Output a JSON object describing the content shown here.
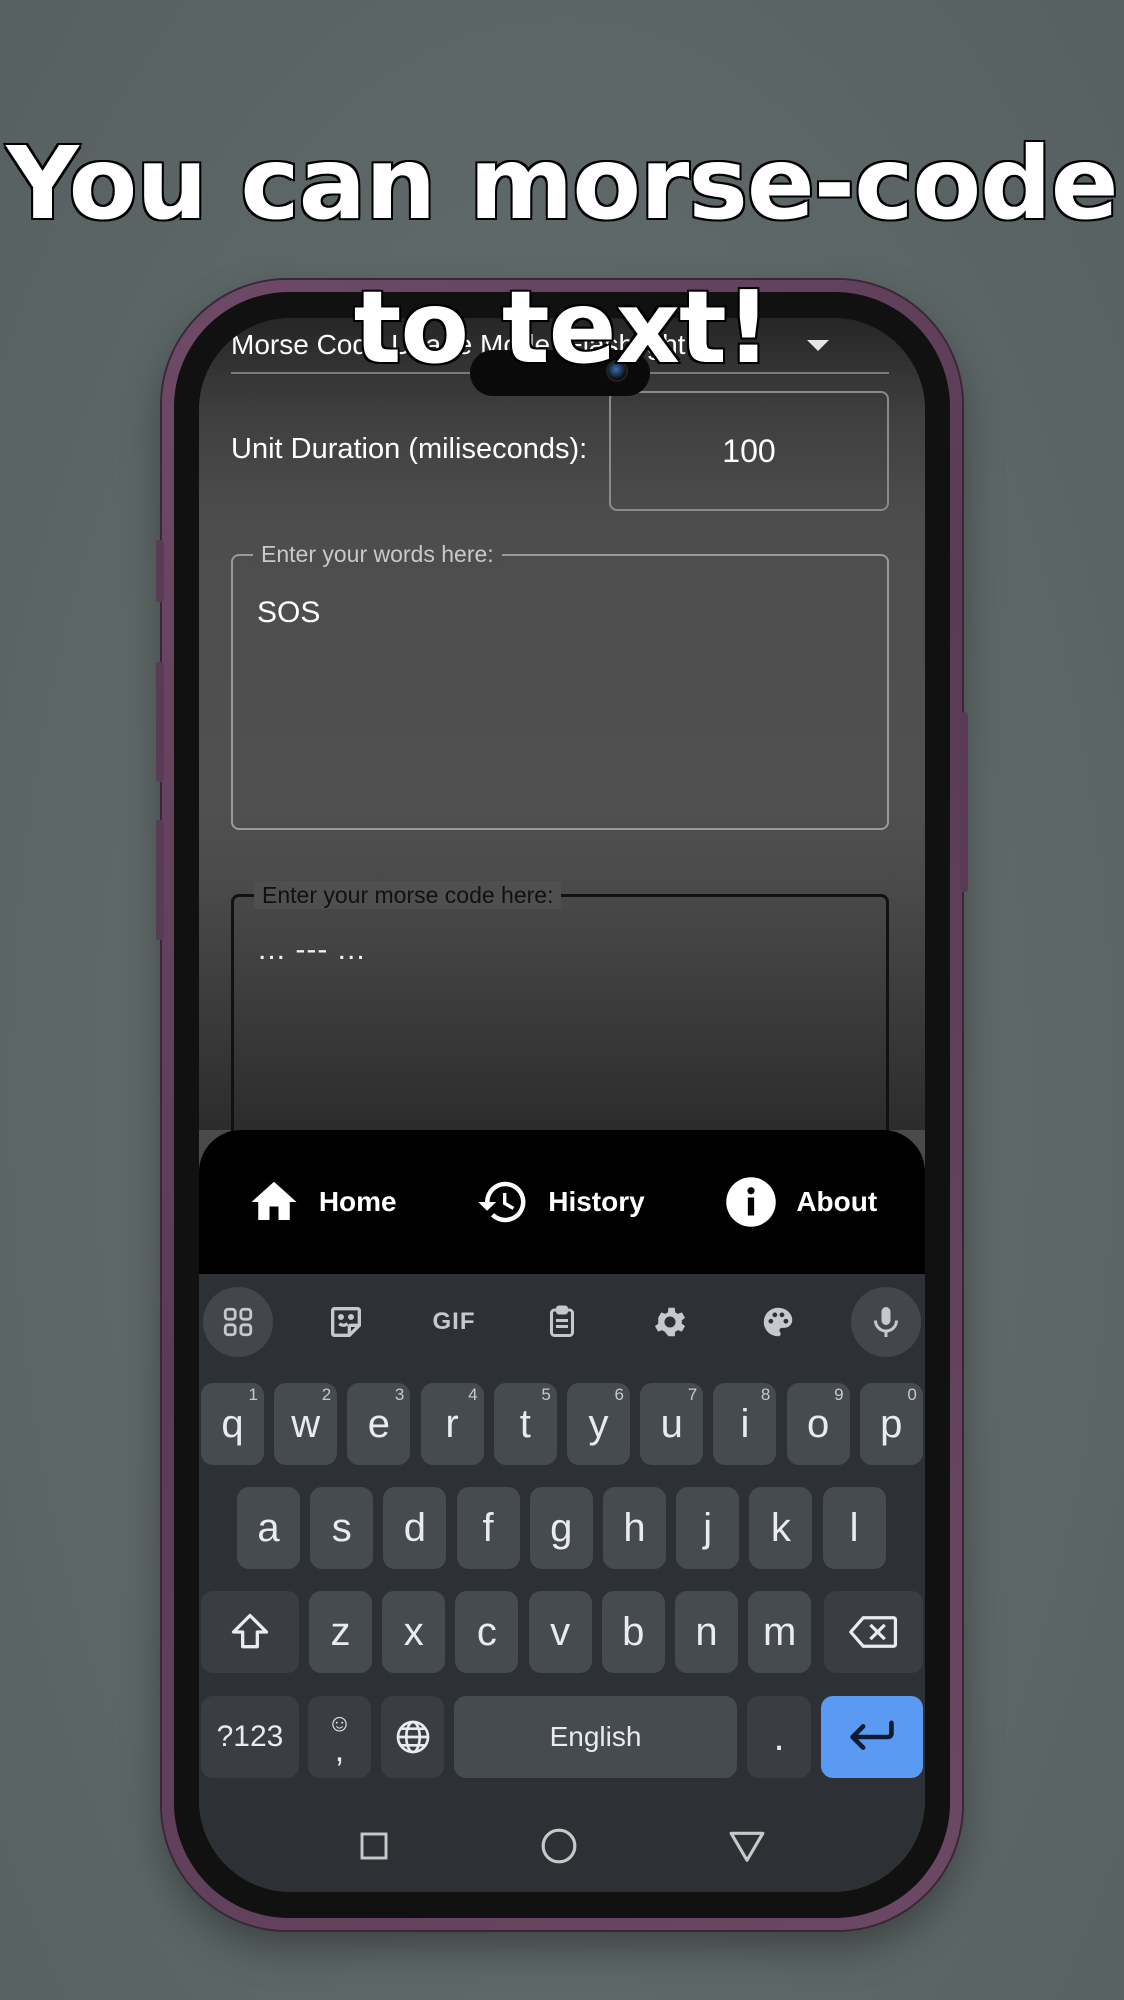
{
  "headline": {
    "line1": "You can morse-code",
    "line2": "to text!"
  },
  "app": {
    "dropdown_label": "Morse Code Usage Mode: Flashlight",
    "unit_duration_label": "Unit Duration (miliseconds):",
    "unit_duration_value": "100",
    "words_field": {
      "label": "Enter your words here:",
      "value": "SOS"
    },
    "morse_field": {
      "label": "Enter your morse code here:",
      "value": "... --- ..."
    }
  },
  "bottom_nav": {
    "items": [
      {
        "label": "Home",
        "icon": "home-icon"
      },
      {
        "label": "History",
        "icon": "history-icon"
      },
      {
        "label": "About",
        "icon": "info-icon"
      }
    ]
  },
  "keyboard": {
    "toolbar": [
      "apps-grid-icon",
      "sticker-icon",
      "GIF",
      "clipboard-icon",
      "gear-icon",
      "palette-icon",
      "mic-icon"
    ],
    "gif_label": "GIF",
    "row1": [
      {
        "k": "q",
        "n": "1"
      },
      {
        "k": "w",
        "n": "2"
      },
      {
        "k": "e",
        "n": "3"
      },
      {
        "k": "r",
        "n": "4"
      },
      {
        "k": "t",
        "n": "5"
      },
      {
        "k": "y",
        "n": "6"
      },
      {
        "k": "u",
        "n": "7"
      },
      {
        "k": "i",
        "n": "8"
      },
      {
        "k": "o",
        "n": "9"
      },
      {
        "k": "p",
        "n": "0"
      }
    ],
    "row2": [
      "a",
      "s",
      "d",
      "f",
      "g",
      "h",
      "j",
      "k",
      "l"
    ],
    "row3": [
      "z",
      "x",
      "c",
      "v",
      "b",
      "n",
      "m"
    ],
    "symbols_label": "?123",
    "emoji_label": "☺",
    "comma_label": ",",
    "space_label": "English",
    "period_label": ".",
    "accent_color": "#5b9af2"
  },
  "system_nav": [
    "recents-icon",
    "home-circle-icon",
    "back-triangle-icon"
  ]
}
